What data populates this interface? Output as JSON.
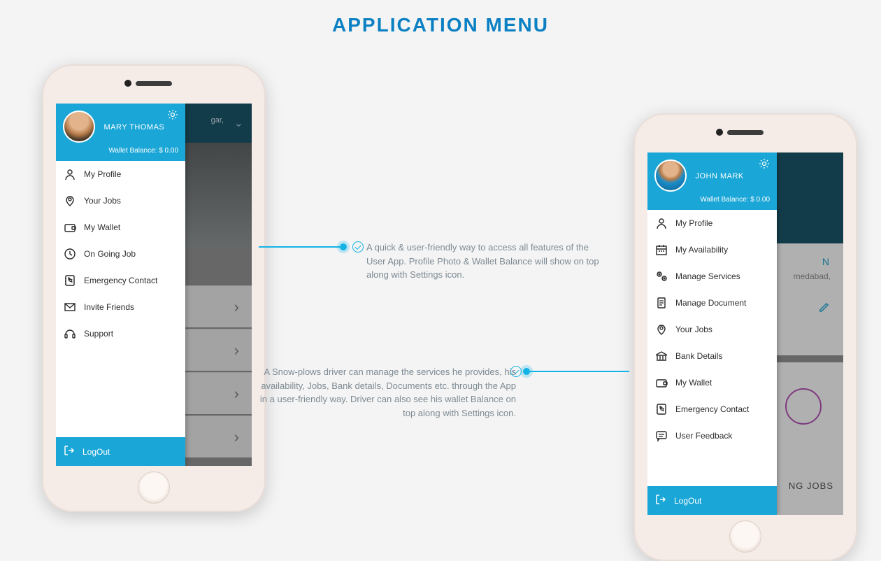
{
  "title": "APPLICATION MENU",
  "user_app": {
    "name": "MARY THOMAS",
    "wallet_label": "Wallet Balance: $ 0.00",
    "bg_location": "gar,",
    "menu": [
      {
        "label": "My Profile",
        "icon": "user-icon"
      },
      {
        "label": "Your Jobs",
        "icon": "map-pin-icon"
      },
      {
        "label": "My Wallet",
        "icon": "wallet-icon"
      },
      {
        "label": "On Going Job",
        "icon": "clock-icon"
      },
      {
        "label": "Emergency Contact",
        "icon": "phone-book-icon"
      },
      {
        "label": "Invite Friends",
        "icon": "envelope-icon"
      },
      {
        "label": "Support",
        "icon": "headset-icon"
      }
    ],
    "logout": "LogOut"
  },
  "driver_app": {
    "name": "JOHN MARK",
    "wallet_label": "Wallet Balance: $ 0.00",
    "bg_hint1": "N",
    "bg_hint2": "medabad,",
    "bg_hint3": "NG JOBS",
    "menu": [
      {
        "label": "My Profile",
        "icon": "user-icon"
      },
      {
        "label": "My Availability",
        "icon": "calendar-icon"
      },
      {
        "label": "Manage Services",
        "icon": "cogs-icon"
      },
      {
        "label": "Manage Document",
        "icon": "document-icon"
      },
      {
        "label": "Your Jobs",
        "icon": "map-pin-icon"
      },
      {
        "label": "Bank Details",
        "icon": "bank-icon"
      },
      {
        "label": "My Wallet",
        "icon": "wallet-icon"
      },
      {
        "label": "Emergency Contact",
        "icon": "phone-book-icon"
      },
      {
        "label": "User Feedback",
        "icon": "chat-icon"
      }
    ],
    "logout": "LogOut"
  },
  "annotations": {
    "user": "A quick & user-friendly way to access all features of the User App. Profile Photo & Wallet Balance will show on top along with Settings icon.",
    "driver": "A Snow-plows driver can manage the services he provides, his availability, Jobs, Bank details, Documents etc. through the App in a user-friendly way. Driver can also see his wallet Balance on top along with Settings icon."
  }
}
